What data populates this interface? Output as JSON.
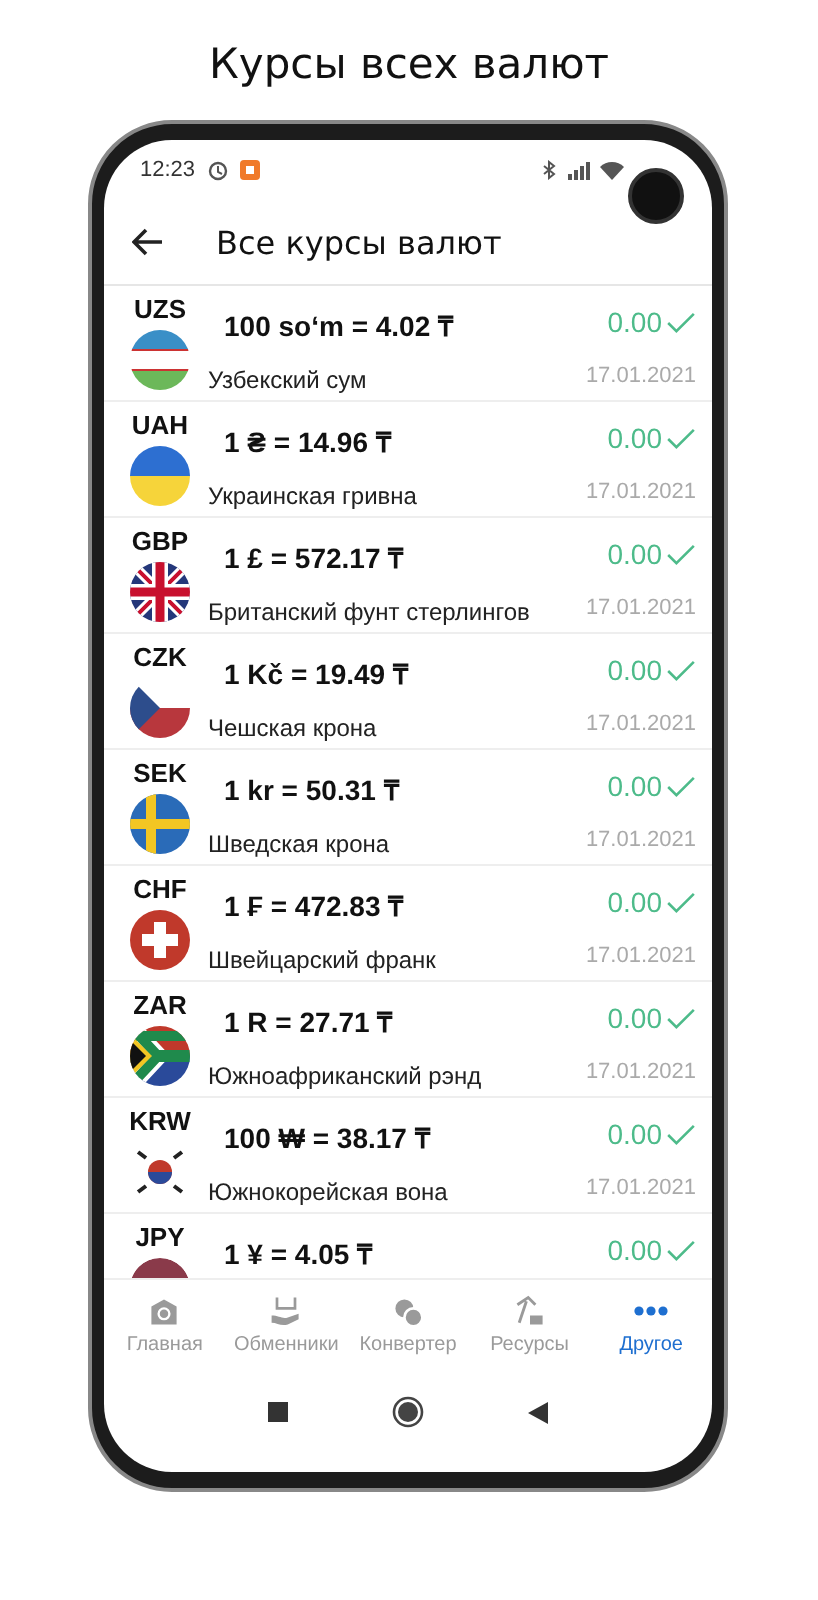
{
  "headline": "Курсы всех валют",
  "status_bar": {
    "time": "12:23"
  },
  "app_bar": {
    "title": "Все курсы валют"
  },
  "rates": [
    {
      "code": "UZS",
      "rate": "100 soʻm = 4.02 ₸",
      "name": "Узбекский сум",
      "change": "0.00",
      "date": "17.01.2021"
    },
    {
      "code": "UAH",
      "rate": "1 ₴ = 14.96 ₸",
      "name": "Украинская гривна",
      "change": "0.00",
      "date": "17.01.2021"
    },
    {
      "code": "GBP",
      "rate": "1 £ = 572.17 ₸",
      "name": "Британский фунт стерлингов",
      "change": "0.00",
      "date": "17.01.2021"
    },
    {
      "code": "CZK",
      "rate": "1 Kč = 19.49 ₸",
      "name": "Чешская крона",
      "change": "0.00",
      "date": "17.01.2021"
    },
    {
      "code": "SEK",
      "rate": "1 kr = 50.31 ₸",
      "name": "Шведская крона",
      "change": "0.00",
      "date": "17.01.2021"
    },
    {
      "code": "CHF",
      "rate": "1 ₣ = 472.83 ₸",
      "name": "Швейцарский франк",
      "change": "0.00",
      "date": "17.01.2021"
    },
    {
      "code": "ZAR",
      "rate": "1 R = 27.71 ₸",
      "name": "Южноафриканский рэнд",
      "change": "0.00",
      "date": "17.01.2021"
    },
    {
      "code": "KRW",
      "rate": "100 ₩ = 38.17 ₸",
      "name": "Южнокорейская вона",
      "change": "0.00",
      "date": "17.01.2021"
    },
    {
      "code": "JPY",
      "rate": "1 ¥ = 4.05 ₸",
      "change": "0.00"
    }
  ],
  "bottom_nav": [
    {
      "label": "Главная",
      "selected": false
    },
    {
      "label": "Обменники",
      "selected": false
    },
    {
      "label": "Конвертер",
      "selected": false
    },
    {
      "label": "Ресурсы",
      "selected": false
    },
    {
      "label": "Другое",
      "selected": true
    }
  ]
}
